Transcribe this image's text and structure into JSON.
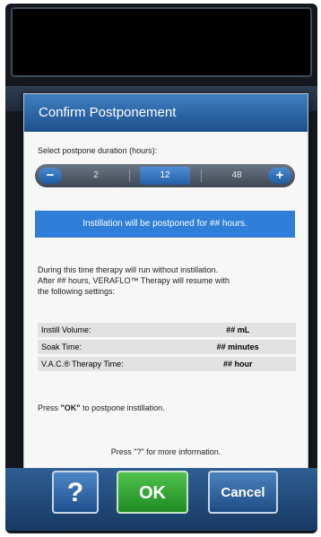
{
  "dialog": {
    "title": "Confirm Postponement",
    "select_label": "Select postpone duration (hours):",
    "duration": {
      "minus": "−",
      "plus": "+",
      "options": [
        "2",
        "12",
        "48"
      ],
      "selected": "12"
    },
    "banner": "Instillation will be postponed for ## hours.",
    "description": [
      "During this time therapy will run without instillation.",
      "After ## hours, VERAFLO™ Therapy will resume with",
      "the following settings:"
    ],
    "settings": [
      {
        "label": "Instill Volume:",
        "value": "## mL"
      },
      {
        "label": "Soak Time:",
        "value": "## minutes"
      },
      {
        "label": "V.A.C.® Therapy Time:",
        "value": "## hour"
      }
    ],
    "ok_instruction_prefix": "Press ",
    "ok_instruction_key": "\"OK\"",
    "ok_instruction_suffix": " to postpone instillation.",
    "help_instruction": "Press \"?\" for more information."
  },
  "footer": {
    "help_label": "?",
    "ok_label": "OK",
    "cancel_label": "Cancel"
  }
}
